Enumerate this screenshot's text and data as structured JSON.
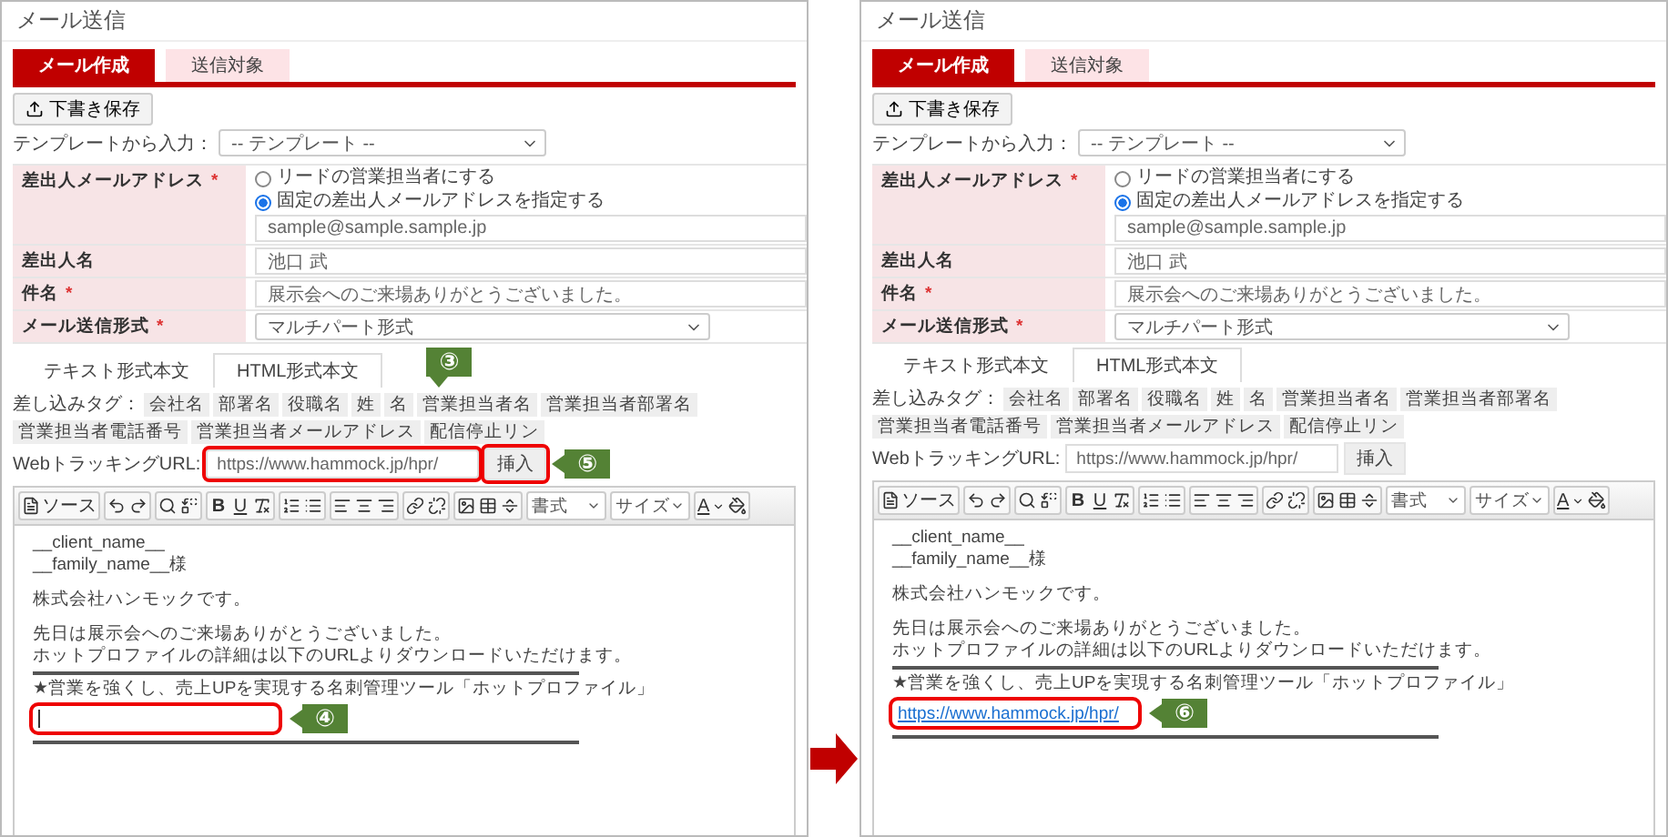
{
  "panels": [
    {
      "title": "メール送信",
      "tabs": [
        {
          "label": "メール作成",
          "selected": true
        },
        {
          "label": "送信対象",
          "selected": false
        }
      ],
      "save_button": "下書き保存",
      "template": {
        "label": "テンプレートから入力：",
        "value": "-- テンプレート --"
      },
      "form": [
        {
          "kind": "radio-input",
          "label": "差出人メールアドレス",
          "required_mark": "*",
          "options": [
            {
              "label": "リードの営業担当者にする",
              "selected": false
            },
            {
              "label": "固定の差出人メールアドレスを指定する",
              "selected": true
            }
          ],
          "value": "sample@sample.sample.jp"
        },
        {
          "kind": "input",
          "label": "差出人名",
          "value": "池口 武"
        },
        {
          "kind": "input",
          "label": "件名",
          "required_mark": "*",
          "value": "展示会へのご来場ありがとうございました。"
        },
        {
          "kind": "select",
          "label": "メール送信形式",
          "required_mark": "*",
          "value": "マルチパート形式"
        }
      ],
      "body_tabs": [
        {
          "label": "テキスト形式本文",
          "selected": false
        },
        {
          "label": "HTML形式本文",
          "selected": true
        }
      ],
      "tags": {
        "label": "差し込みタグ：",
        "items": [
          "会社名",
          "部署名",
          "役職名",
          "姓",
          "名",
          "営業担当者名",
          "営業担当者部署名",
          "営業担当者電話番号",
          "営業担当者メールアドレス",
          "配信停止リン"
        ]
      },
      "tracking": {
        "label": "WebトラッキングURL:",
        "value": "https://www.hammock.jp/hpr/",
        "highlighted": true,
        "callout": "③",
        "button": "挿入",
        "button_highlighted": true,
        "button_callout": "⑤"
      },
      "toolbar": {
        "source": "ソース",
        "bold": "B",
        "underline": "U",
        "format": "書式",
        "size": "サイズ",
        "text_color": "A"
      },
      "body": [
        {
          "kind": "text",
          "text": "__client_name__"
        },
        {
          "kind": "text",
          "text": "__family_name__様"
        },
        {
          "kind": "blank"
        },
        {
          "kind": "text",
          "text": "株式会社ハンモックです。"
        },
        {
          "kind": "blank"
        },
        {
          "kind": "text",
          "text": "先日は展示会へのご来場ありがとうございました。"
        },
        {
          "kind": "text",
          "text": "ホットプロファイルの詳細は以下のURLよりダウンロードいただけます。"
        },
        {
          "kind": "rule"
        },
        {
          "kind": "text",
          "text": "★営業を強くし、売上UPを実現する名刺管理ツール「ホットプロファイル」"
        },
        {
          "kind": "cursor",
          "highlighted": true,
          "callout": "④"
        },
        {
          "kind": "rule"
        }
      ]
    },
    {
      "title": "メール送信",
      "tabs": [
        {
          "label": "メール作成",
          "selected": true
        },
        {
          "label": "送信対象",
          "selected": false
        }
      ],
      "save_button": "下書き保存",
      "template": {
        "label": "テンプレートから入力：",
        "value": "-- テンプレート --"
      },
      "form": [
        {
          "kind": "radio-input",
          "label": "差出人メールアドレス",
          "required_mark": "*",
          "options": [
            {
              "label": "リードの営業担当者にする",
              "selected": false
            },
            {
              "label": "固定の差出人メールアドレスを指定する",
              "selected": true
            }
          ],
          "value": "sample@sample.sample.jp"
        },
        {
          "kind": "input",
          "label": "差出人名",
          "value": "池口 武"
        },
        {
          "kind": "input",
          "label": "件名",
          "required_mark": "*",
          "value": "展示会へのご来場ありがとうございました。"
        },
        {
          "kind": "select",
          "label": "メール送信形式",
          "required_mark": "*",
          "value": "マルチパート形式"
        }
      ],
      "body_tabs": [
        {
          "label": "テキスト形式本文",
          "selected": false
        },
        {
          "label": "HTML形式本文",
          "selected": true
        }
      ],
      "tags": {
        "label": "差し込みタグ：",
        "items": [
          "会社名",
          "部署名",
          "役職名",
          "姓",
          "名",
          "営業担当者名",
          "営業担当者部署名",
          "営業担当者電話番号",
          "営業担当者メールアドレス",
          "配信停止リン"
        ]
      },
      "tracking": {
        "label": "WebトラッキングURL:",
        "value": "https://www.hammock.jp/hpr/",
        "highlighted": false,
        "button": "挿入",
        "button_highlighted": false
      },
      "toolbar": {
        "source": "ソース",
        "bold": "B",
        "underline": "U",
        "format": "書式",
        "size": "サイズ",
        "text_color": "A"
      },
      "body": [
        {
          "kind": "text",
          "text": "__client_name__"
        },
        {
          "kind": "text",
          "text": "__family_name__様"
        },
        {
          "kind": "blank"
        },
        {
          "kind": "text",
          "text": "株式会社ハンモックです。"
        },
        {
          "kind": "blank"
        },
        {
          "kind": "text",
          "text": "先日は展示会へのご来場ありがとうございました。"
        },
        {
          "kind": "text",
          "text": "ホットプロファイルの詳細は以下のURLよりダウンロードいただけます。"
        },
        {
          "kind": "rule"
        },
        {
          "kind": "text",
          "text": "★営業を強くし、売上UPを実現する名刺管理ツール「ホットプロファイル」"
        },
        {
          "kind": "link",
          "text": "https://www.hammock.jp/hpr/",
          "highlighted": true,
          "callout": "⑥"
        },
        {
          "kind": "rule"
        }
      ]
    }
  ]
}
